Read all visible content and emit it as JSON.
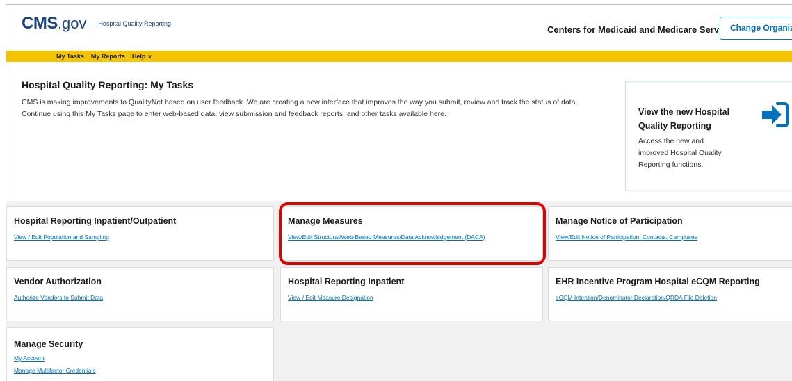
{
  "header": {
    "logo_cms": "CMS",
    "logo_gov": ".gov",
    "logo_subtitle": "Hospital Quality Reporting",
    "org_name": "Centers for Medicaid and Medicare Services",
    "change_org_label": "Change Organization"
  },
  "nav": {
    "items": [
      {
        "label": "My Tasks"
      },
      {
        "label": "My Reports"
      },
      {
        "label": "Help"
      }
    ]
  },
  "intro": {
    "title": "Hospital Quality Reporting: My Tasks",
    "text": "CMS is making improvements to QualityNet based on user feedback. We are creating a new interface that improves the way you submit, review and track the status of data. Continue using this My Tasks page to enter web-based data, view submission and feedback reports, and other tasks available here."
  },
  "promo": {
    "title": "View the new Hospital Quality Reporting",
    "description": "Access the new and improved Hospital Quality Reporting functions.",
    "icon": "sign-in-arrow-icon",
    "icon_color": "#0071bc"
  },
  "tiles": [
    {
      "title": "Hospital Reporting Inpatient/Outpatient",
      "links": [
        "View / Edit Population and Sampling"
      ]
    },
    {
      "title": "Manage Measures",
      "links": [
        "View/Edit Structural/Web-Based Measures/Data Acknowledgement (DACA)"
      ]
    },
    {
      "title": "Manage Notice of Participation",
      "links": [
        "View/Edit Notice of Participation, Contacts, Campuses"
      ]
    },
    {
      "title": "Vendor Authorization",
      "links": [
        "Authorize Vendors to Submit Data"
      ]
    },
    {
      "title": "Hospital Reporting Inpatient",
      "links": [
        "View / Edit Measure Designation"
      ]
    },
    {
      "title": "EHR Incentive Program Hospital eCQM Reporting",
      "links": [
        "eCQM Intention/Denominator Declaration/QRDA File Deletion"
      ]
    },
    {
      "title": "Manage Security",
      "links": [
        "My Account",
        "Manage Multifactor Credentials"
      ]
    }
  ],
  "colors": {
    "brand_blue": "#1a4480",
    "link_blue": "#0071bc",
    "nav_yellow": "#f5c400",
    "highlight_red": "#e00000"
  }
}
